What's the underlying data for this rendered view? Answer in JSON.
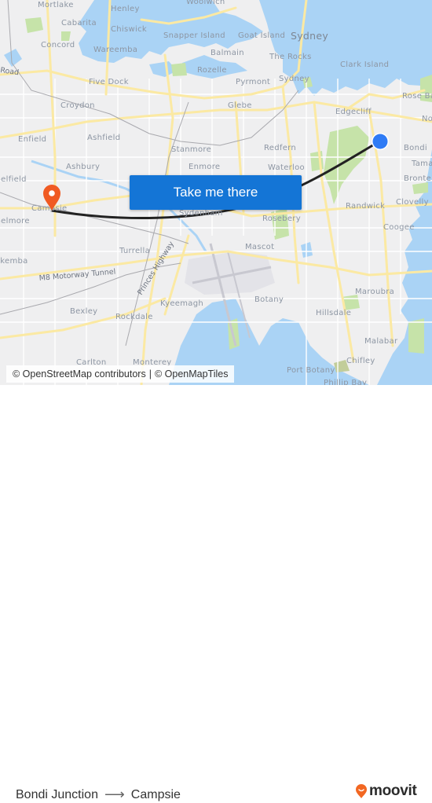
{
  "map": {
    "origin": {
      "name": "Bondi Junction",
      "marker": "blue-dot",
      "color": "#2f7bf5"
    },
    "destination": {
      "name": "Campsie",
      "marker": "pin-icon",
      "color": "#f05a22"
    },
    "route_line_color": "#222222",
    "water_color": "#aad3f5",
    "park_color": "#c6e3a9",
    "road_color": "#fbe9a3",
    "labels": [
      {
        "text": "Mortlake",
        "kind": "suburb"
      },
      {
        "text": "Henley",
        "kind": "suburb"
      },
      {
        "text": "Woolwich",
        "kind": "suburb"
      },
      {
        "text": "Cabarita",
        "kind": "suburb"
      },
      {
        "text": "Chiswick",
        "kind": "suburb"
      },
      {
        "text": "Snapper Island",
        "kind": "suburb"
      },
      {
        "text": "Goat Island",
        "kind": "suburb"
      },
      {
        "text": "Sydney",
        "kind": "city"
      },
      {
        "text": "Concord",
        "kind": "suburb"
      },
      {
        "text": "Wareemba",
        "kind": "suburb"
      },
      {
        "text": "Balmain",
        "kind": "suburb"
      },
      {
        "text": "The Rocks",
        "kind": "suburb"
      },
      {
        "text": "Clark Island",
        "kind": "suburb"
      },
      {
        "text": "Road",
        "kind": "road"
      },
      {
        "text": "Rozelle",
        "kind": "suburb"
      },
      {
        "text": "Five Dock",
        "kind": "suburb"
      },
      {
        "text": "Pyrmont",
        "kind": "suburb"
      },
      {
        "text": "Sydney",
        "kind": "suburb"
      },
      {
        "text": "Rose Bay",
        "kind": "suburb"
      },
      {
        "text": "Croydon",
        "kind": "suburb"
      },
      {
        "text": "Glebe",
        "kind": "suburb"
      },
      {
        "text": "Edgecliff",
        "kind": "suburb"
      },
      {
        "text": "North Bondi",
        "kind": "suburb"
      },
      {
        "text": "Enfield",
        "kind": "suburb"
      },
      {
        "text": "Ashfield",
        "kind": "suburb"
      },
      {
        "text": "Stanmore",
        "kind": "suburb"
      },
      {
        "text": "Redfern",
        "kind": "suburb"
      },
      {
        "text": "Bondi",
        "kind": "suburb"
      },
      {
        "text": "Ashbury",
        "kind": "suburb"
      },
      {
        "text": "Enmore",
        "kind": "suburb"
      },
      {
        "text": "Waterloo",
        "kind": "suburb"
      },
      {
        "text": "Tamarama",
        "kind": "suburb"
      },
      {
        "text": "Belfield",
        "kind": "suburb"
      },
      {
        "text": "Bronte",
        "kind": "suburb"
      },
      {
        "text": "Campsie",
        "kind": "suburb"
      },
      {
        "text": "Randwick",
        "kind": "suburb"
      },
      {
        "text": "Clovelly",
        "kind": "suburb"
      },
      {
        "text": "Belmore",
        "kind": "suburb"
      },
      {
        "text": "Sydenham",
        "kind": "suburb"
      },
      {
        "text": "Rosebery",
        "kind": "suburb"
      },
      {
        "text": "Coogee",
        "kind": "suburb"
      },
      {
        "text": "Turrella",
        "kind": "suburb"
      },
      {
        "text": "Mascot",
        "kind": "suburb"
      },
      {
        "text": "Lakemba",
        "kind": "suburb"
      },
      {
        "text": "M8 Motorway Tunnel",
        "kind": "road"
      },
      {
        "text": "Princes Highway",
        "kind": "road"
      },
      {
        "text": "Maroubra",
        "kind": "suburb"
      },
      {
        "text": "Kyeemagh",
        "kind": "suburb"
      },
      {
        "text": "Botany",
        "kind": "suburb"
      },
      {
        "text": "Hillsdale",
        "kind": "suburb"
      },
      {
        "text": "Bexley",
        "kind": "suburb"
      },
      {
        "text": "Rockdale",
        "kind": "suburb"
      },
      {
        "text": "Malabar",
        "kind": "suburb"
      },
      {
        "text": "Carlton",
        "kind": "suburb"
      },
      {
        "text": "Monterey",
        "kind": "suburb"
      },
      {
        "text": "Port Botany",
        "kind": "suburb"
      },
      {
        "text": "Chifley",
        "kind": "suburb"
      },
      {
        "text": "Phillip Bay",
        "kind": "suburb"
      }
    ],
    "cta_label": "Take me there",
    "attribution": {
      "osm": "© OpenStreetMap contributors",
      "separator": "|",
      "omt": "© OpenMapTiles"
    }
  },
  "footer": {
    "from": "Bondi Junction",
    "arrow_icon": "arrow-right-icon",
    "to": "Campsie",
    "brand": "moovit",
    "brand_color": "#f26722"
  }
}
